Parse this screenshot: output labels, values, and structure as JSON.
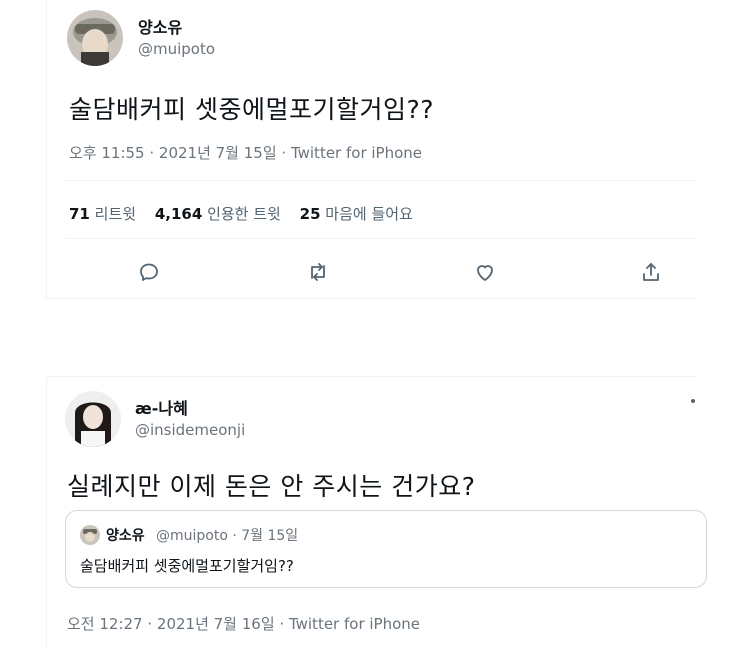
{
  "tweet1": {
    "name": "양소유",
    "handle": "@muipoto",
    "text": "술담배커피 셋중에멀포기할거임??",
    "meta": "오후 11:55 · 2021년 7월 15일 · Twitter for iPhone",
    "stats": {
      "retweets_count": "71",
      "retweets_label": "리트윗",
      "quotes_count": "4,164",
      "quotes_label": "인용한 트윗",
      "likes_count": "25",
      "likes_label": "마음에 들어요"
    }
  },
  "tweet2": {
    "name": "æ-나혜",
    "handle": "@insidemeonji",
    "text": "실례지만 이제 돈은 안 주시는 건가요?",
    "quote": {
      "name": "양소유",
      "meta": "@muipoto · 7월 15일",
      "text": "술담배커피 셋중에멀포기할거임??"
    },
    "meta": "오전 12:27 · 2021년 7월 16일 · Twitter for iPhone"
  }
}
